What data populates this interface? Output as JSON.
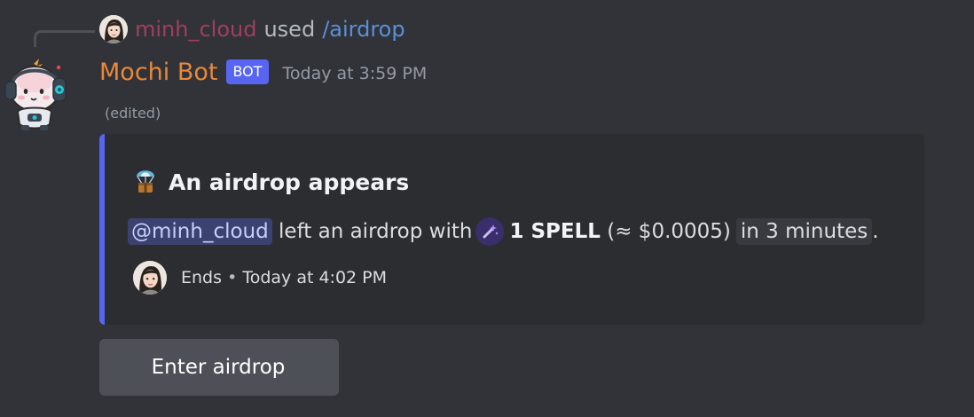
{
  "reply": {
    "user": "minh_cloud",
    "used_text": "used",
    "command": "/airdrop"
  },
  "header": {
    "bot_name": "Mochi Bot",
    "badge": "BOT",
    "timestamp": "Today at 3:59 PM",
    "edited": "(edited)"
  },
  "embed": {
    "accent_color": "#5865f2",
    "title_icon": "parachute-box-icon",
    "title": "An airdrop appears",
    "mention": "@minh_cloud",
    "desc_before": "left an airdrop with",
    "token_icon": "spell-wand-icon",
    "token_amount": "1 SPELL",
    "token_value": "(≈ $0.0005)",
    "duration": "in 3 minutes",
    "desc_end": ".",
    "footer_label": "Ends",
    "footer_sep": "•",
    "footer_time": "Today at 4:02 PM"
  },
  "button": {
    "label": "Enter airdrop"
  },
  "colors": {
    "background": "#313338",
    "embed_bg": "#2b2d31",
    "bot_name": "#e8883a",
    "reply_user": "#a13f5b",
    "command": "#5b8fd9",
    "badge": "#5865f2",
    "button": "#4e5058"
  }
}
